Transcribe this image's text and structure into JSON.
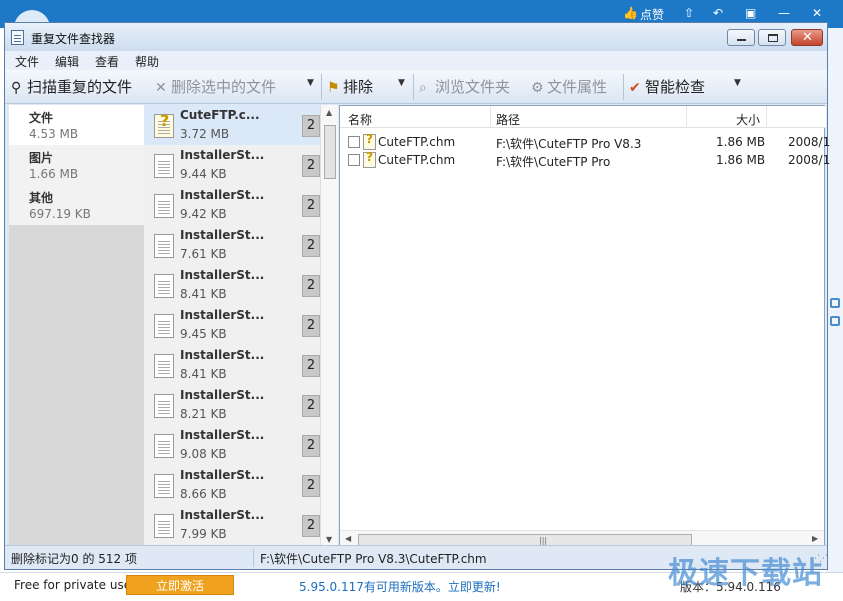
{
  "background": {
    "items": [
      "点赞"
    ],
    "icons": [
      "thumbs-up-icon",
      "pin-icon",
      "back-icon",
      "shirt-icon",
      "minimize-icon",
      "close-icon"
    ]
  },
  "window": {
    "title": "重复文件查找器",
    "close_glyph": "✕"
  },
  "menu": [
    "文件",
    "编辑",
    "查看",
    "帮助"
  ],
  "toolbar": {
    "scan": "扫描重复的文件",
    "delete_selected": "删除选中的文件",
    "exclude": "排除",
    "browse_folder": "浏览文件夹",
    "file_properties": "文件属性",
    "smart_check": "智能检查"
  },
  "categories": [
    {
      "name": "文件",
      "size": "4.53 MB"
    },
    {
      "name": "图片",
      "size": "1.66 MB"
    },
    {
      "name": "其他",
      "size": "697.19 KB"
    }
  ],
  "duplicates": [
    {
      "name": "CuteFTP.c...",
      "size": "3.72 MB",
      "count": "2"
    },
    {
      "name": "InstallerSt...",
      "size": "9.44 KB",
      "count": "2"
    },
    {
      "name": "InstallerSt...",
      "size": "9.42 KB",
      "count": "2"
    },
    {
      "name": "InstallerSt...",
      "size": "7.61 KB",
      "count": "2"
    },
    {
      "name": "InstallerSt...",
      "size": "8.41 KB",
      "count": "2"
    },
    {
      "name": "InstallerSt...",
      "size": "9.45 KB",
      "count": "2"
    },
    {
      "name": "InstallerSt...",
      "size": "8.41 KB",
      "count": "2"
    },
    {
      "name": "InstallerSt...",
      "size": "8.21 KB",
      "count": "2"
    },
    {
      "name": "InstallerSt...",
      "size": "9.08 KB",
      "count": "2"
    },
    {
      "name": "InstallerSt...",
      "size": "8.66 KB",
      "count": "2"
    },
    {
      "name": "InstallerSt...",
      "size": "7.99 KB",
      "count": "2"
    }
  ],
  "detail": {
    "columns": {
      "name": "名称",
      "path": "路径",
      "size": "大小"
    },
    "rows": [
      {
        "name": "CuteFTP.chm",
        "path": "F:\\软件\\CuteFTP Pro V8.3",
        "size": "1.86 MB",
        "date": "2008/1"
      },
      {
        "name": "CuteFTP.chm",
        "path": "F:\\软件\\CuteFTP Pro",
        "size": "1.86 MB",
        "date": "2008/1"
      }
    ]
  },
  "status": {
    "left": "删除标记为0 的 512 项",
    "right": "F:\\软件\\CuteFTP Pro V8.3\\CuteFTP.chm"
  },
  "footer": {
    "free": "Free for private use",
    "activate": "立即激活",
    "update": "5.95.0.117有可用新版本。立即更新!",
    "version": "版本：5.94.0.116"
  },
  "watermark": "极速下载站",
  "colors": {
    "accent": "#1e78c8",
    "activate": "#f0a21e",
    "update_link": "#1c6fbf"
  }
}
